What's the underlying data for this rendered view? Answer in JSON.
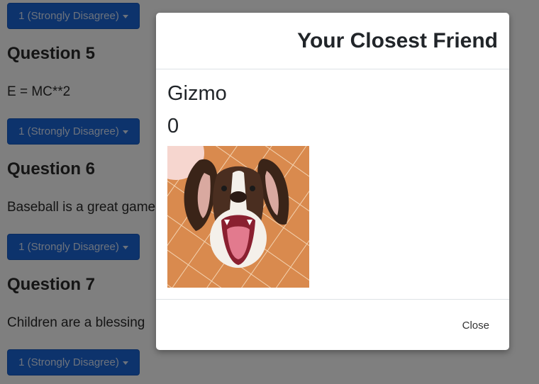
{
  "background": {
    "dropdown_label": "1 (Strongly Disagree)",
    "questions": [
      {
        "heading": "Question 5",
        "text": "E = MC**2"
      },
      {
        "heading": "Question 6",
        "text": "Baseball is a great game"
      },
      {
        "heading": "Question 7",
        "text": "Children are a blessing"
      }
    ]
  },
  "modal": {
    "title": "Your Closest Friend",
    "friend_name": "Gizmo",
    "friend_score": "0",
    "photo_icon": "dog-photo",
    "close_label": "Close"
  },
  "colors": {
    "dropdown_bg": "#1a66d8",
    "backdrop": "rgba(0,0,0,0.5)"
  }
}
